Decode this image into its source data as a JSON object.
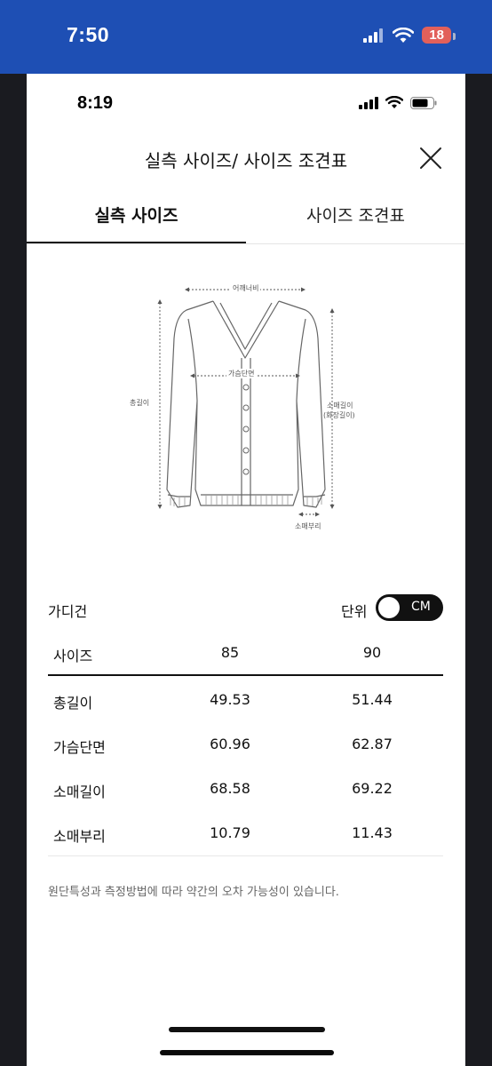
{
  "outer_status": {
    "time": "7:50",
    "battery": "18"
  },
  "inner_status": {
    "time": "8:19"
  },
  "modal": {
    "title": "실측 사이즈/ 사이즈 조견표"
  },
  "tabs": [
    {
      "label": "실측 사이즈",
      "active": true
    },
    {
      "label": "사이즈 조견표",
      "active": false
    }
  ],
  "diagram": {
    "labels": {
      "shoulder": "어깨너비",
      "chest": "가슴단면",
      "total_length": "총길이",
      "sleeve_length": "소매길이",
      "sleeve_length_alt": "(화장길이)",
      "sleeve_cuff": "소매부리"
    }
  },
  "product": {
    "name": "가디건"
  },
  "unit": {
    "label": "단위",
    "value": "CM"
  },
  "table": {
    "headers": [
      "사이즈",
      "85",
      "90"
    ],
    "rows": [
      [
        "총길이",
        "49.53",
        "51.44"
      ],
      [
        "가슴단면",
        "60.96",
        "62.87"
      ],
      [
        "소매길이",
        "68.58",
        "69.22"
      ],
      [
        "소매부리",
        "10.79",
        "11.43"
      ]
    ]
  },
  "note": "원단특성과 측정방법에 따라 약간의 오차 가능성이 있습니다.",
  "colors": {
    "outer_bar": "#1e4fb4",
    "frame": "#1a1b20",
    "battery_badge": "#e2605a"
  }
}
